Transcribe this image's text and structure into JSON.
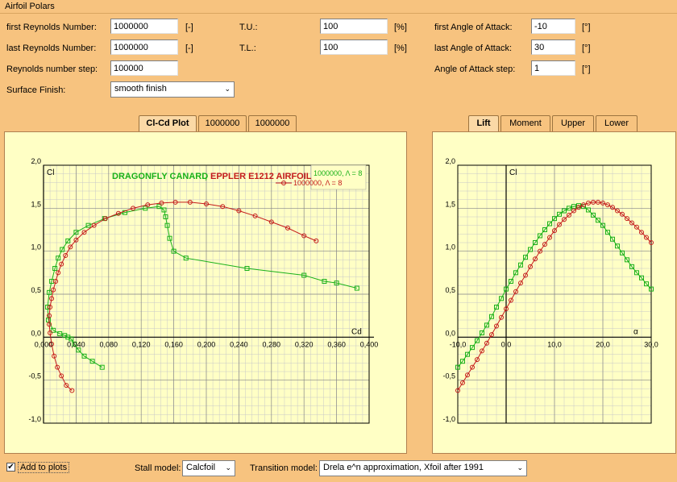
{
  "window": {
    "title": "Airfoil Polars"
  },
  "form": {
    "first_re": {
      "label": "first Reynolds Number:",
      "value": "1000000",
      "unit": "[-]"
    },
    "last_re": {
      "label": "last Reynolds Number:",
      "value": "1000000",
      "unit": "[-]"
    },
    "re_step": {
      "label": "Reynolds number step:",
      "value": "100000"
    },
    "surface": {
      "label": "Surface Finish:",
      "value": "smooth finish"
    },
    "tu": {
      "label": "T.U.:",
      "value": "100",
      "unit": "[%]"
    },
    "tl": {
      "label": "T.L.:",
      "value": "100",
      "unit": "[%]"
    },
    "first_aoa": {
      "label": "first Angle of Attack:",
      "value": "-10",
      "unit": "[°]"
    },
    "last_aoa": {
      "label": "last Angle of Attack:",
      "value": "30",
      "unit": "[°]"
    },
    "aoa_step": {
      "label": "Angle of Attack step:",
      "value": "1",
      "unit": "[°]"
    }
  },
  "left_tabs": [
    "Cl-Cd Plot",
    "1000000",
    "1000000"
  ],
  "right_tabs": [
    "Lift",
    "Moment",
    "Upper",
    "Lower"
  ],
  "bottom": {
    "add_to_plots": "Add to plots",
    "stall_label": "Stall model:",
    "stall_value": "Calcfoil",
    "transition_label": "Transition model:",
    "transition_value": "Drela e^n approximation, Xfoil after 1991"
  },
  "colors": {
    "green": "#19b119",
    "red": "#c41a1a",
    "panel": "#ffffc5"
  },
  "chart_data": [
    {
      "type": "line",
      "title_part1": "DRAGONFLY CANARD",
      "title_sep": ", ",
      "title_part2": "EPPLER E1212 AIRFOIL",
      "xlabel": "Cd",
      "ylabel": "Cl",
      "xlim": [
        0,
        0.4
      ],
      "ylim": [
        -1,
        2
      ],
      "xticks": [
        "0,000",
        "0,040",
        "0,080",
        "0,120",
        "0,160",
        "0,200",
        "0,240",
        "0,280",
        "0,320",
        "0,360",
        "0,400"
      ],
      "yticks": [
        "-1,0",
        "-0,5",
        "0,0",
        "0,5",
        "1,0",
        "1,5",
        "2,0"
      ],
      "legend": [
        "1000000, Λ = 8",
        "1000000, Λ = 8"
      ],
      "series": [
        {
          "name": "1000000, Λ = 8",
          "color": "green",
          "marker": "square",
          "x": [
            0.072,
            0.06,
            0.05,
            0.043,
            0.038,
            0.034,
            0.03,
            0.026,
            0.02,
            0.012,
            0.006,
            0.005,
            0.007,
            0.01,
            0.014,
            0.018,
            0.023,
            0.03,
            0.04,
            0.055,
            0.075,
            0.1,
            0.125,
            0.142,
            0.148,
            0.15,
            0.152,
            0.155,
            0.16,
            0.175,
            0.25,
            0.32,
            0.345,
            0.36,
            0.385
          ],
          "y": [
            -0.35,
            -0.28,
            -0.22,
            -0.15,
            -0.08,
            -0.02,
            0.0,
            0.02,
            0.04,
            0.08,
            0.2,
            0.35,
            0.52,
            0.65,
            0.8,
            0.92,
            1.02,
            1.12,
            1.22,
            1.3,
            1.38,
            1.45,
            1.5,
            1.52,
            1.48,
            1.4,
            1.3,
            1.15,
            1.0,
            0.92,
            0.8,
            0.72,
            0.65,
            0.63,
            0.57
          ]
        },
        {
          "name": "1000000, Λ = 8",
          "color": "red",
          "marker": "circle",
          "x": [
            0.035,
            0.028,
            0.022,
            0.017,
            0.013,
            0.01,
            0.008,
            0.007,
            0.007,
            0.008,
            0.01,
            0.012,
            0.015,
            0.018,
            0.022,
            0.027,
            0.033,
            0.04,
            0.05,
            0.062,
            0.076,
            0.092,
            0.11,
            0.128,
            0.145,
            0.162,
            0.18,
            0.2,
            0.22,
            0.24,
            0.26,
            0.28,
            0.3,
            0.32,
            0.335
          ],
          "y": [
            -0.62,
            -0.56,
            -0.45,
            -0.35,
            -0.22,
            -0.08,
            0.05,
            0.15,
            0.25,
            0.35,
            0.45,
            0.55,
            0.65,
            0.75,
            0.85,
            0.95,
            1.05,
            1.13,
            1.22,
            1.3,
            1.38,
            1.44,
            1.5,
            1.54,
            1.56,
            1.57,
            1.57,
            1.55,
            1.52,
            1.47,
            1.41,
            1.34,
            1.27,
            1.18,
            1.12
          ]
        }
      ]
    },
    {
      "type": "line",
      "xlabel": "α",
      "ylabel": "Cl",
      "xlim": [
        -10,
        30
      ],
      "ylim": [
        -1,
        2
      ],
      "xticks": [
        "-10,0",
        "0,0",
        "10,0",
        "20,0",
        "30,0"
      ],
      "yticks": [
        "-1,0",
        "-0,5",
        "0,0",
        "0,5",
        "1,0",
        "1,5",
        "2,0"
      ],
      "series": [
        {
          "name": "",
          "color": "green",
          "marker": "square",
          "x": [
            -10,
            -9,
            -8,
            -7,
            -6,
            -5,
            -4,
            -3,
            -2,
            -1,
            0,
            1,
            2,
            3,
            4,
            5,
            6,
            7,
            8,
            9,
            10,
            11,
            12,
            13,
            14,
            15,
            16,
            17,
            18,
            19,
            20,
            21,
            22,
            23,
            24,
            25,
            26,
            27,
            28,
            29,
            30
          ],
          "y": [
            -0.35,
            -0.28,
            -0.2,
            -0.12,
            -0.04,
            0.05,
            0.14,
            0.24,
            0.35,
            0.45,
            0.56,
            0.65,
            0.75,
            0.84,
            0.93,
            1.02,
            1.1,
            1.18,
            1.25,
            1.32,
            1.38,
            1.43,
            1.47,
            1.5,
            1.52,
            1.53,
            1.52,
            1.48,
            1.42,
            1.36,
            1.3,
            1.22,
            1.14,
            1.06,
            0.98,
            0.9,
            0.82,
            0.75,
            0.69,
            0.62,
            0.56
          ]
        },
        {
          "name": "",
          "color": "red",
          "marker": "circle",
          "x": [
            -10,
            -9,
            -8,
            -7,
            -6,
            -5,
            -4,
            -3,
            -2,
            -1,
            0,
            1,
            2,
            3,
            4,
            5,
            6,
            7,
            8,
            9,
            10,
            11,
            12,
            13,
            14,
            15,
            16,
            17,
            18,
            19,
            20,
            21,
            22,
            23,
            24,
            25,
            26,
            27,
            28,
            29,
            30
          ],
          "y": [
            -0.62,
            -0.53,
            -0.44,
            -0.35,
            -0.26,
            -0.16,
            -0.07,
            0.03,
            0.13,
            0.23,
            0.33,
            0.43,
            0.53,
            0.63,
            0.72,
            0.82,
            0.91,
            1.0,
            1.08,
            1.16,
            1.24,
            1.31,
            1.37,
            1.42,
            1.47,
            1.51,
            1.54,
            1.56,
            1.57,
            1.57,
            1.56,
            1.54,
            1.51,
            1.47,
            1.43,
            1.38,
            1.33,
            1.28,
            1.22,
            1.16,
            1.1
          ]
        }
      ]
    }
  ]
}
